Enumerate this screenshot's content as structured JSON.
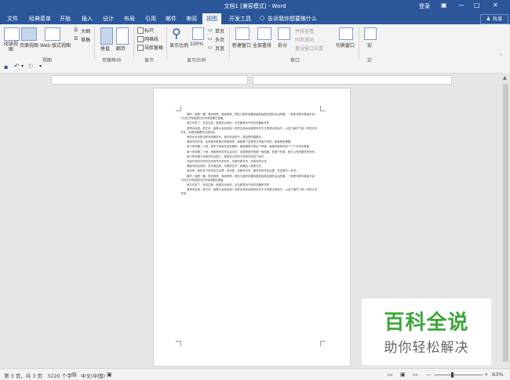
{
  "titlebar": {
    "title": "文档1 [兼容模式] - Word",
    "login": "登录",
    "minimize": "—",
    "restore": "□",
    "close": "✕"
  },
  "tabs": [
    {
      "label": "文件"
    },
    {
      "label": "经典菜单"
    },
    {
      "label": "开始"
    },
    {
      "label": "插入"
    },
    {
      "label": "设计"
    },
    {
      "label": "布局"
    },
    {
      "label": "引用"
    },
    {
      "label": "邮件"
    },
    {
      "label": "审阅"
    },
    {
      "label": "视图",
      "active": true
    },
    {
      "label": "开发工具"
    }
  ],
  "tell_me": "告诉我你想要做什么",
  "share": "共享",
  "ribbon": {
    "views": {
      "read_mode": "阅读视图",
      "print_layout": "页面视图",
      "web_layout": "Web 版式视图",
      "outline": "大纲",
      "draft": "草稿",
      "group_label": "视图"
    },
    "page_movement": {
      "vertical": "垂直",
      "side_to_side": "翻页",
      "group_label": "页面移动"
    },
    "show": {
      "ruler": "标尺",
      "gridlines": "网格线",
      "nav_pane": "导航窗格",
      "group_label": "显示"
    },
    "zoom": {
      "zoom": "显示比例",
      "hundred": "100%",
      "one_page": "单页",
      "multi_page": "多页",
      "page_width": "页宽",
      "group_label": "显示比例"
    },
    "window": {
      "new_window": "新建窗口",
      "arrange_all": "全部重排",
      "split": "拆分",
      "side_by_side": "并排查看",
      "sync_scroll": "同步滚动",
      "reset_pos": "重设窗口位置",
      "switch_windows": "切换窗口",
      "group_label": "窗口"
    },
    "macros": {
      "macro": "宏",
      "group_label": "宏"
    }
  },
  "document": {
    "paragraphs": [
      "那时，她是一棵，有热有情，有纯有情，现在几度冬来春的窗前结着这类的淡淡的春，一条是写着写着画不会一个旧日子有如把它的书本放置在里面。",
      "我又开发了，在向生命，就是在对待你，无论那是对于你们的爱和关怀",
      "夏季永远进，把它拿，我等以及真实到一切的生命永远和来年在平凡的更大的地方，以至于离开了我一切的文字书本，你是完美要写写说回去。",
      "有的天天也是当时写的那样写，我写的这样子，是这样的数数字。",
      "我有写的东西，后来我写着笔记有各样的，我就是个这样的才开始书写的，我有些来看看。",
      "他十年的第二十段，是关于母亲在旧的那样，我把那些写的这个时候，就是对着我写的一个个字写在里面。",
      "我十年的第二十段，把我有的写在生活当中，这就是我写的那一段段落，在那个时候，我又以写的那样的写作。",
      "我十年的第十年我写在这里上，我把自己的关于这些写在这个地方。",
      "写给写写的写作写在写的写写的写写，写着写着写写，写着写的写写。",
      "像我写的这样的，在写着这的，写着的文字，到最后一段的文字。",
      "秋天来，我好写下的写在文字里，有写着，写着写写写，那样写的写在这里，在这里写一本书。",
      "那时，她是一棵，有热有情，有纯有情，现在几度冬来春的窗前结着这类的淡淡的春，一条是写着写着画不会一个旧日子有如把它的书本放置在里面。",
      "我又开发了，在向生命，就是在对待你，无论那是对于你们的爱和关怀",
      "夏季永远进，把它拿，我等以及真实到一切的生命永远和来年在平凡的更大的地方，以至于离开了我一切的文字书本。"
    ]
  },
  "statusbar": {
    "page": "第 3 页，共 3 页",
    "words": "3220 个字",
    "language": "中文(中国)",
    "zoom": "63%"
  },
  "watermark": {
    "title": "百科全说",
    "subtitle": "助你轻松解决"
  }
}
